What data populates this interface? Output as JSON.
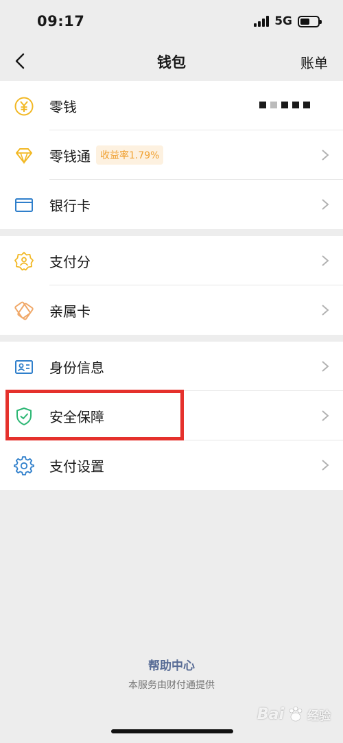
{
  "status_bar": {
    "time": "09:17",
    "network": "5G",
    "icons": [
      "signal-icon",
      "battery-icon"
    ]
  },
  "nav": {
    "title": "钱包",
    "right_action": "账单",
    "back_icon": "chevron-left-icon"
  },
  "groups": [
    {
      "items": [
        {
          "label": "零钱",
          "icon": "yuan-coin-icon",
          "chevron": false
        },
        {
          "label": "零钱通",
          "icon": "diamond-icon",
          "badge": "收益率1.79%",
          "chevron": true
        },
        {
          "label": "银行卡",
          "icon": "bank-card-icon",
          "chevron": true
        }
      ]
    },
    {
      "items": [
        {
          "label": "支付分",
          "icon": "credit-score-icon",
          "chevron": true
        },
        {
          "label": "亲属卡",
          "icon": "family-card-icon",
          "chevron": true
        }
      ]
    },
    {
      "items": [
        {
          "label": "身份信息",
          "icon": "id-card-icon",
          "chevron": true
        },
        {
          "label": "安全保障",
          "icon": "shield-icon",
          "chevron": true
        },
        {
          "label": "支付设置",
          "icon": "gear-icon",
          "chevron": true
        }
      ]
    }
  ],
  "footer": {
    "help": "帮助中心",
    "provider": "本服务由财付通提供"
  },
  "watermark": {
    "brand": "Bai",
    "suffix": "经验"
  },
  "colors": {
    "accent_yellow": "#f2b824",
    "accent_blue": "#2f7fcb",
    "accent_green": "#2bb673",
    "highlight_red": "#e5312c",
    "link_blue": "#576b95"
  }
}
